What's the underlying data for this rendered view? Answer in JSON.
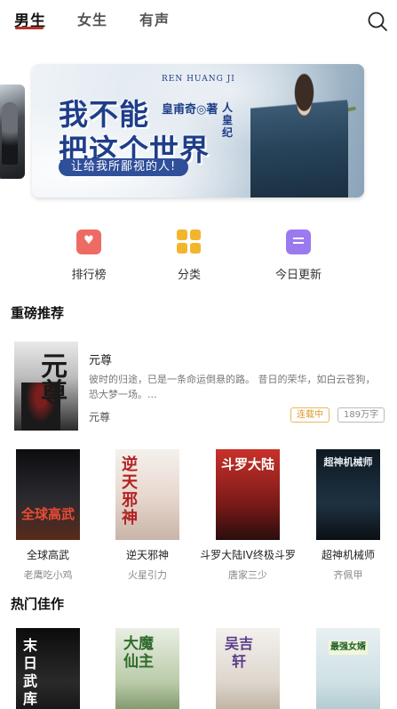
{
  "tabs": [
    {
      "label": "男生",
      "active": true
    },
    {
      "label": "女生",
      "active": false
    },
    {
      "label": "有声",
      "active": false
    }
  ],
  "icons": {
    "search": "search-icon",
    "rank": "heart-badge-icon",
    "category": "grid-icon",
    "update": "book-icon"
  },
  "banner": {
    "title_line1": "我不能",
    "title_line2": "把这个世界",
    "pinyin": "REN HUANG JI",
    "author": "皇甫奇◎著",
    "series": "人皇纪",
    "slogan": "让给我所鄙视的人!"
  },
  "shortcuts": [
    {
      "label": "排行榜"
    },
    {
      "label": "分类"
    },
    {
      "label": "今日更新"
    }
  ],
  "sections": {
    "recommend": "重磅推荐",
    "hot": "热门佳作"
  },
  "featured": {
    "title": "元尊",
    "description": "彼时的归途，已是一条命运倒悬的路。 昔日的荣华，如白云苍狗，恐大梦一场。...",
    "author": "元尊",
    "status": "连载中",
    "count": "189万字",
    "cover_text": "元尊"
  },
  "recommend_books": [
    {
      "title": "全球高武",
      "author": "老鹰吃小鸡",
      "cover_text": "全球高武"
    },
    {
      "title": "逆天邪神",
      "author": "火星引力",
      "cover_text": "逆天邪神"
    },
    {
      "title": "斗罗大陆IV终极斗罗",
      "author": "唐家三少",
      "cover_text": "斗罗大陆"
    },
    {
      "title": "超神机械师",
      "author": "齐佩甲",
      "cover_text": "超神机械师"
    }
  ],
  "hot_books": [
    {
      "cover_text": "末日武库"
    },
    {
      "cover_text": "大魔仙主"
    },
    {
      "cover_text": "吴吉轩"
    },
    {
      "cover_text": "最强女婿"
    }
  ],
  "colors": {
    "accent": "#b8322e",
    "status": "#d99a2c",
    "banner_blue": "#1e3e8a"
  }
}
